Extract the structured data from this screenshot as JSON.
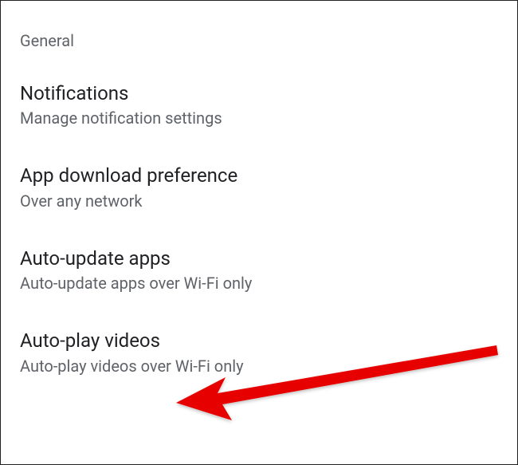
{
  "section": {
    "header": "General"
  },
  "settings": [
    {
      "title": "Notifications",
      "subtitle": "Manage notification settings"
    },
    {
      "title": "App download preference",
      "subtitle": "Over any network"
    },
    {
      "title": "Auto-update apps",
      "subtitle": "Auto-update apps over Wi-Fi only"
    },
    {
      "title": "Auto-play videos",
      "subtitle": "Auto-play videos over Wi-Fi only"
    }
  ]
}
